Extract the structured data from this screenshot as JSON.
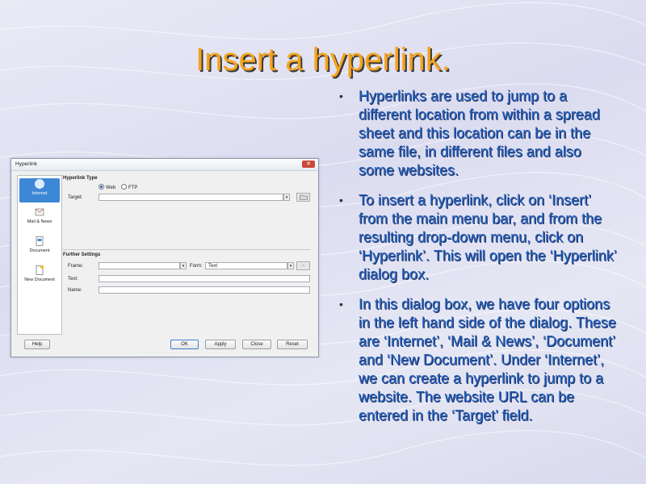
{
  "slide": {
    "title": "Insert a hyperlink.",
    "bullets": [
      "Hyperlinks are used to jump to a different location from within a spread sheet and this location can be in the same file, in different files and also some websites.",
      "To insert a hyperlink, click on ‘Insert’ from the main menu bar, and from the resulting drop-down menu, click on ‘Hyperlink’. This will open the ‘Hyperlink’ dialog box.",
      "In this dialog box, we have four options in the left hand side of the dialog. These are ‘Internet’, ‘Mail & News’, ‘Document’ and ‘New Document’. Under ‘Internet’, we can create a hyperlink to jump to a website. The website URL can be entered in the ‘Target’ field."
    ],
    "bullet_glyph": "•"
  },
  "dialog": {
    "title": "Hyperlink",
    "close_glyph": "✕",
    "side": [
      "Internet",
      "Mail & News",
      "Document",
      "New Document"
    ],
    "hyperlink_type_heading": "Hyperlink Type",
    "radio_web": "Web",
    "radio_ftp": "FTP",
    "target_label": "Target:",
    "further_heading": "Further Settings",
    "frame_label": "Frame:",
    "form_label": "Form:",
    "form_value": "Text",
    "text_label": "Text:",
    "name_label": "Name:",
    "buttons": {
      "help": "Help",
      "ok": "OK",
      "apply": "Apply",
      "close": "Close",
      "reset": "Reset"
    }
  },
  "colors": {
    "title": "#f5a21c",
    "bullet_text": "#1f5fbf",
    "selected_side": "#3c88d6"
  }
}
